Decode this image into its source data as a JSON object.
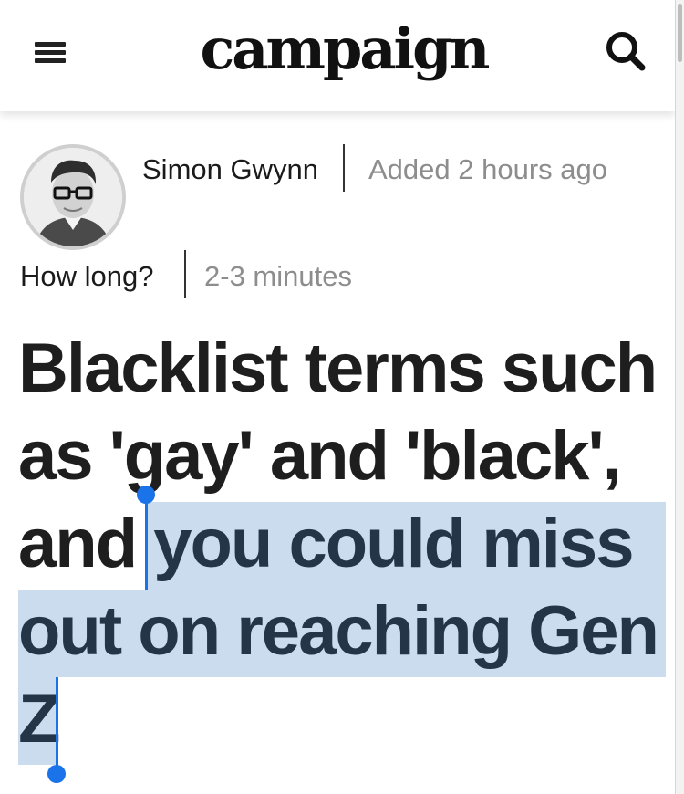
{
  "header": {
    "menu_icon": "hamburger-menu-icon",
    "logo_text": "campaign",
    "search_icon": "search-icon"
  },
  "byline": {
    "author": "Simon Gwynn",
    "added": "Added 2 hours ago",
    "how_long_label": "How long?",
    "how_long_value": "2-3 minutes",
    "avatar_icon": "author-avatar"
  },
  "headline": {
    "line1": "Blacklist terms such",
    "line2": "as 'gay' and 'black',",
    "line3_before": "and ",
    "line3_selected": "you could miss",
    "line4": "out on reaching Gen",
    "line5": "Z"
  },
  "selection": {
    "highlight_color": "#cadcee",
    "handle_color": "#1a73e8"
  }
}
